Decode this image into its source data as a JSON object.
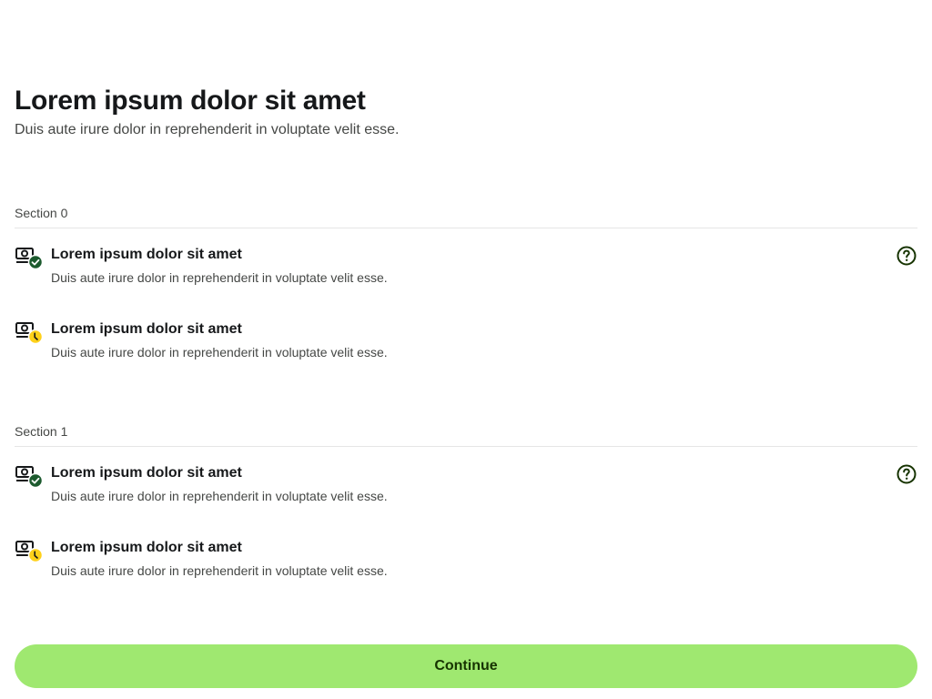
{
  "header": {
    "title": "Lorem ipsum dolor sit amet",
    "subtitle": "Duis aute irure dolor in reprehenderit in voluptate velit esse."
  },
  "sections": [
    {
      "heading": "Section 0",
      "items": [
        {
          "title": "Lorem ipsum dolor sit amet",
          "description": "Duis aute irure dolor in reprehenderit in voluptate velit esse.",
          "icon": "cash-check-icon",
          "status": "complete",
          "has_help": true
        },
        {
          "title": "Lorem ipsum dolor sit amet",
          "description": "Duis aute irure dolor in reprehenderit in voluptate velit esse.",
          "icon": "cash-pending-icon",
          "status": "pending",
          "has_help": false
        }
      ]
    },
    {
      "heading": "Section 1",
      "items": [
        {
          "title": "Lorem ipsum dolor sit amet",
          "description": "Duis aute irure dolor in reprehenderit in voluptate velit esse.",
          "icon": "cash-check-icon",
          "status": "complete",
          "has_help": true
        },
        {
          "title": "Lorem ipsum dolor sit amet",
          "description": "Duis aute irure dolor in reprehenderit in voluptate velit esse.",
          "icon": "cash-pending-icon",
          "status": "pending",
          "has_help": false
        }
      ]
    }
  ],
  "continue_button": {
    "label": "Continue"
  },
  "colors": {
    "accent": "#9fe870",
    "accent_text": "#163300",
    "complete_badge": "#1c5a2e",
    "pending_badge": "#ffd11a",
    "help_icon": "#163300"
  }
}
